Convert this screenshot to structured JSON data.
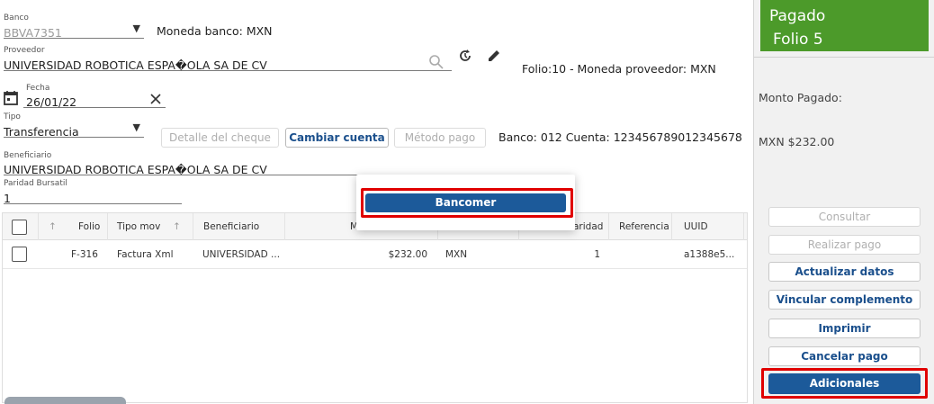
{
  "form": {
    "banco_label": "Banco",
    "banco_value": "BBVA7351",
    "moneda_banco": "Moneda banco: MXN",
    "proveedor_label": "Proveedor",
    "proveedor_value": "UNIVERSIDAD ROBOTICA ESPA�OLA SA DE CV",
    "folio_moneda": "Folio:10 - Moneda proveedor: MXN",
    "fecha_label": "Fecha",
    "fecha_value": "26/01/22",
    "tipo_label": "Tipo",
    "tipo_value": "Transferencia",
    "detalle_cheque": "Detalle del cheque",
    "cambiar_cuenta": "Cambiar cuenta",
    "metodo_pago": "Método pago",
    "banco_cuenta": "Banco: 012 Cuenta: 123456789012345678",
    "beneficiario_label": "Beneficiario",
    "beneficiario_value": "UNIVERSIDAD ROBOTICA ESPA�OLA SA DE CV",
    "paridad_label": "Paridad Bursatil",
    "paridad_value": "1"
  },
  "popup": {
    "option": "Bancomer"
  },
  "table": {
    "headers": [
      "Folio",
      "Tipo mov",
      "Beneficiario",
      "M",
      "",
      "aridad",
      "Referencia",
      "UUID"
    ],
    "row": {
      "folio": "F-316",
      "tipo_mov": "Factura Xml",
      "beneficiario": "UNIVERSIDAD ...",
      "monto": "$232.00",
      "moneda": "MXN",
      "paridad": "1",
      "referencia": "",
      "uuid": "a1388e5..."
    }
  },
  "status": {
    "title": "Pagado",
    "folio": "Folio 5",
    "color": "#4c9a2a"
  },
  "summary": {
    "monto_label": "Monto Pagado:",
    "monto_value": "MXN $232.00"
  },
  "actions": {
    "consultar": "Consultar",
    "realizar_pago": "Realizar pago",
    "actualizar_datos": "Actualizar datos",
    "vincular_complemento": "Vincular complemento",
    "imprimir": "Imprimir",
    "cancelar_pago": "Cancelar pago",
    "adicionales": "Adicionales"
  },
  "icons": {
    "search": "search-icon",
    "refresh": "refresh-icon",
    "edit": "pencil-icon",
    "calendar": "calendar-icon",
    "clear": "close-icon",
    "dropdown": "chevron-down-icon",
    "sort": "sort-arrow-icon"
  }
}
